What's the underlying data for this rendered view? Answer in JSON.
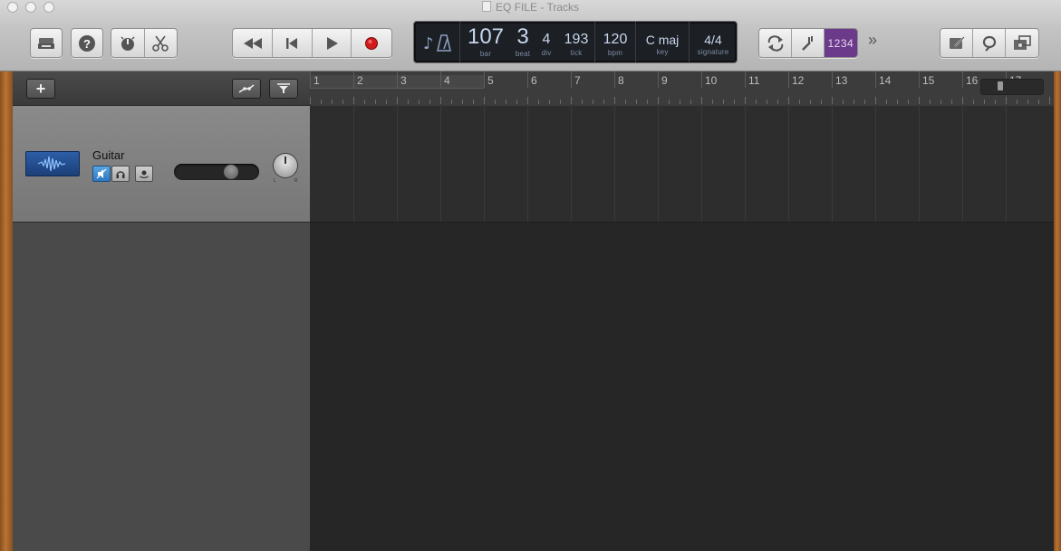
{
  "window": {
    "title": "EQ FILE - Tracks"
  },
  "toolbar": {
    "library_icon": "library-icon",
    "help_icon": "help-icon",
    "smart_controls_icon": "smart-controls-icon",
    "editors_icon": "scissors-icon",
    "rewind_icon": "rewind-icon",
    "goto_start_icon": "goto-start-icon",
    "play_icon": "play-icon",
    "record_icon": "record-icon",
    "cycle_icon": "cycle-icon",
    "tuner_icon": "tuner-icon",
    "count_in_label": "1234",
    "more_label": "»",
    "notepad_icon": "notepad-icon",
    "loop_browser_icon": "loop-icon",
    "media_browser_icon": "media-browser-icon"
  },
  "lcd": {
    "bar": {
      "value": "107",
      "label": "bar"
    },
    "beat": {
      "value": "3",
      "label": "beat"
    },
    "div": {
      "value": "4",
      "label": "div"
    },
    "tick": {
      "value": "193",
      "label": "tick"
    },
    "bpm": {
      "value": "120",
      "label": "bpm"
    },
    "key": {
      "value": "C maj",
      "label": "key"
    },
    "signature": {
      "value": "4/4",
      "label": "signature"
    }
  },
  "track_header": {
    "add_label": "+"
  },
  "tracks": [
    {
      "name": "Guitar",
      "volume_fraction": 0.72,
      "pan_left": "L",
      "pan_right": "R"
    }
  ],
  "ruler": {
    "bars": [
      "1",
      "2",
      "3",
      "4",
      "5",
      "6",
      "7",
      "8",
      "9",
      "10",
      "11",
      "12",
      "13",
      "14",
      "15",
      "16",
      "17"
    ]
  },
  "colors": {
    "accent_purple": "#6b3a8a",
    "record_red": "#d11c1c",
    "mute_blue": "#3a8ad0"
  }
}
